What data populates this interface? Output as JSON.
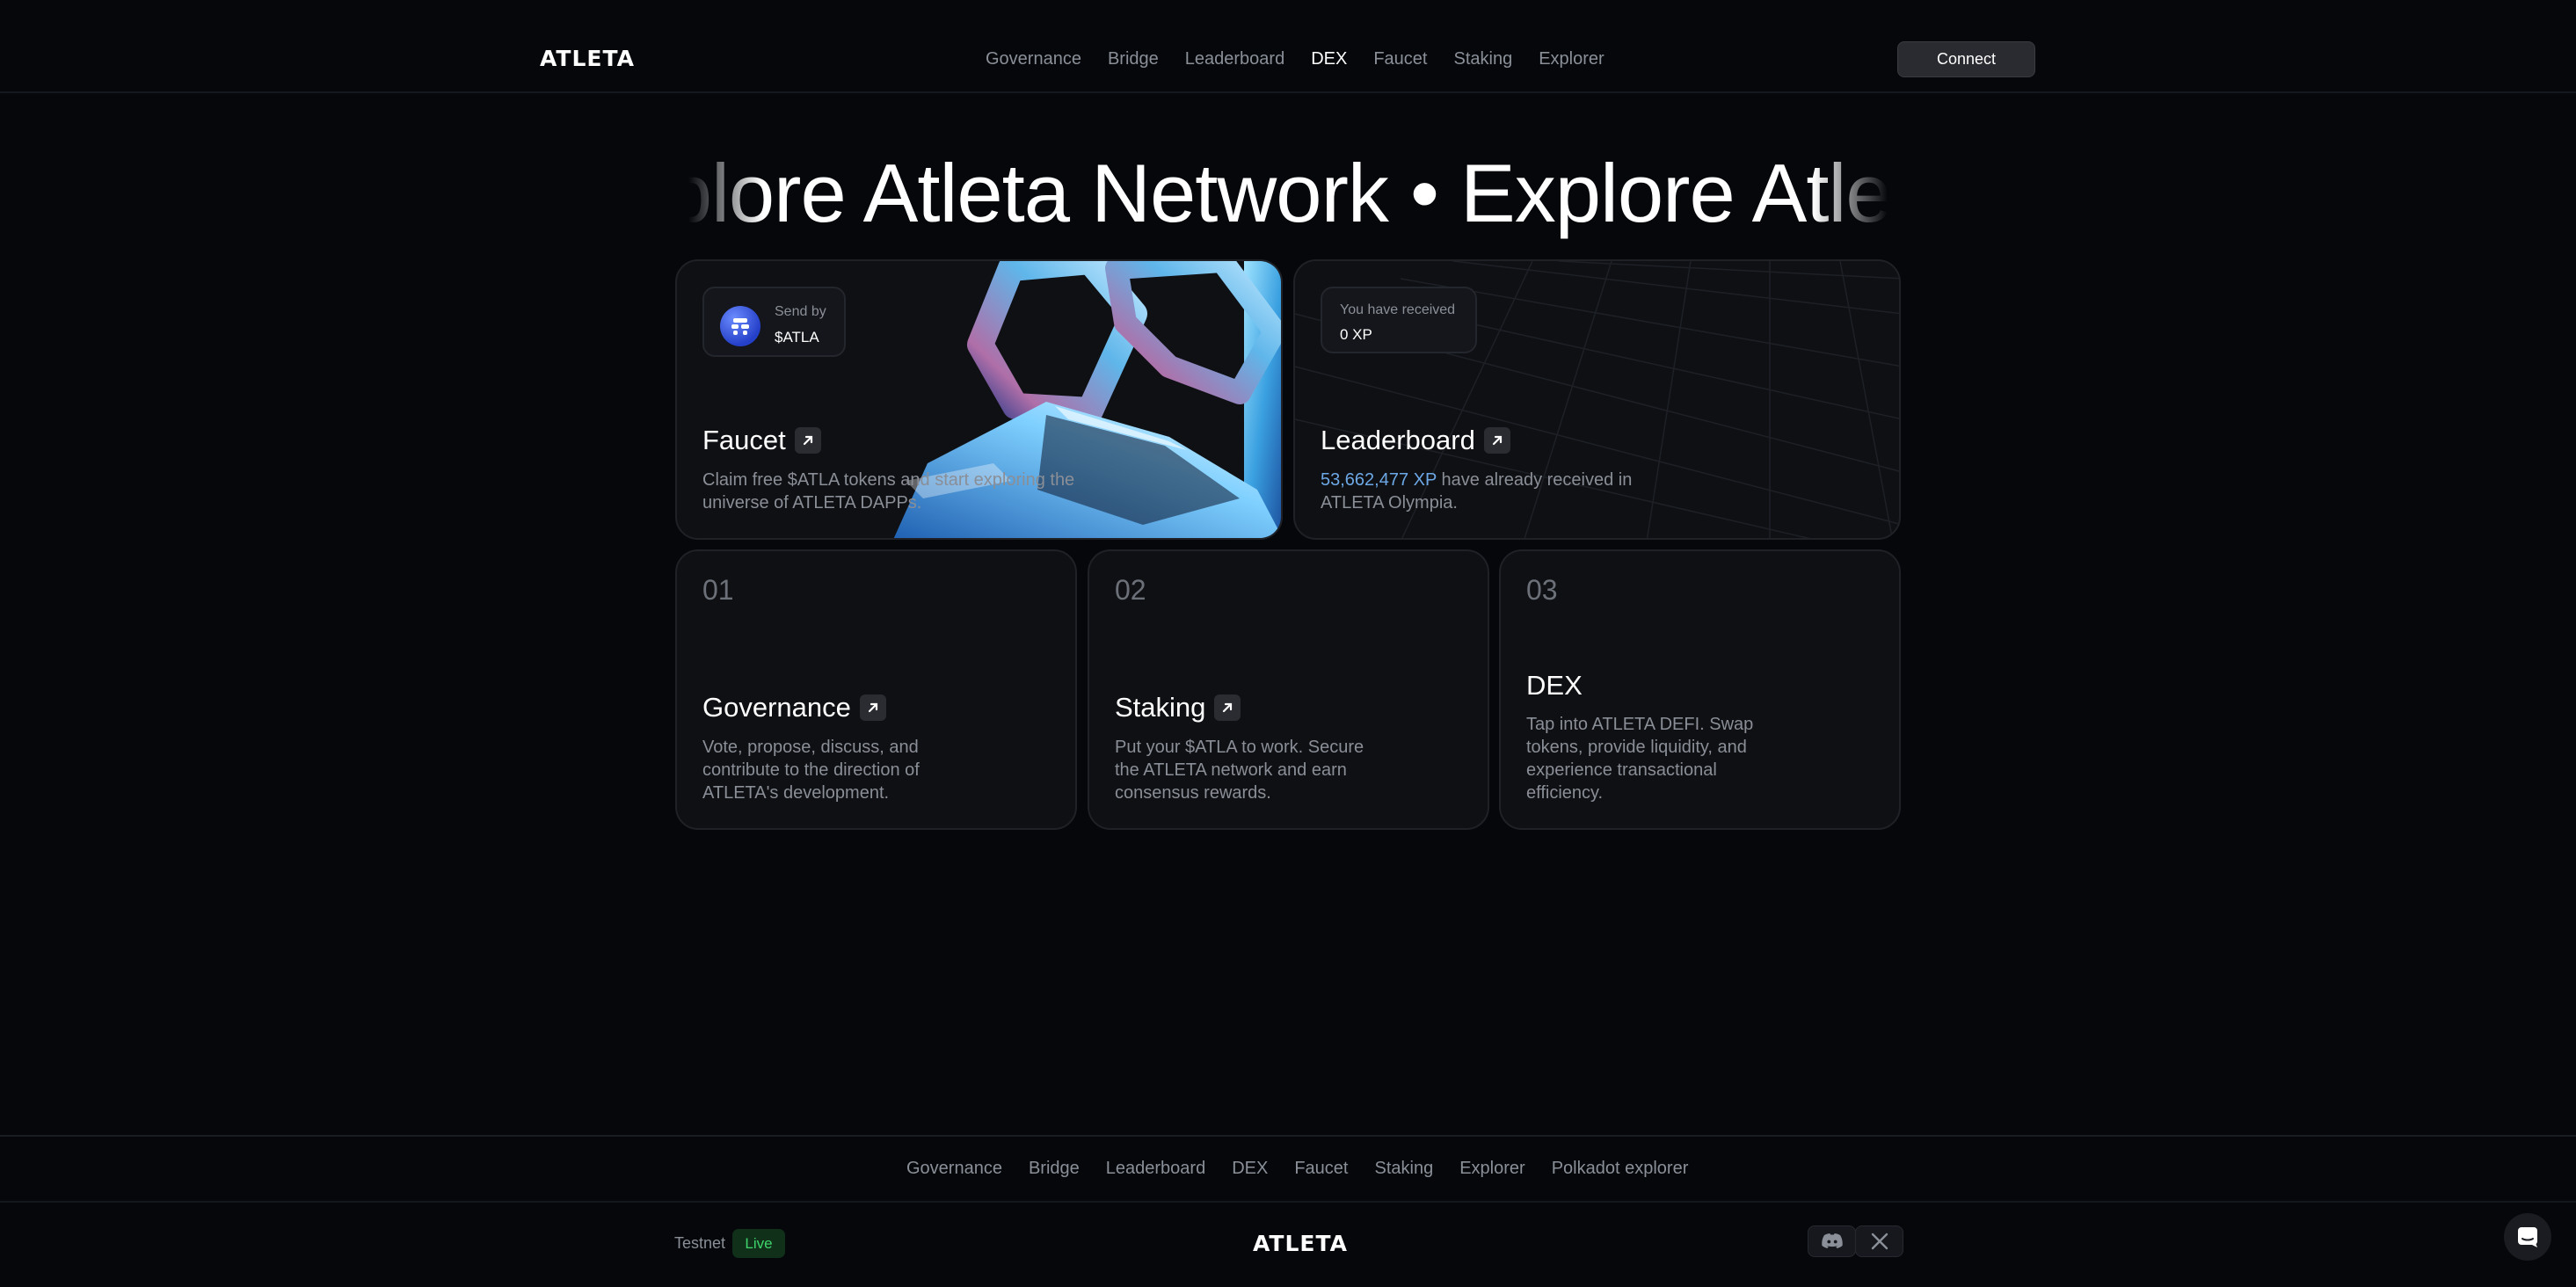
{
  "header": {
    "logo": "ATLETA",
    "nav": [
      {
        "label": "Governance",
        "active": false
      },
      {
        "label": "Bridge",
        "active": false
      },
      {
        "label": "Leaderboard",
        "active": false
      },
      {
        "label": "DEX",
        "active": true
      },
      {
        "label": "Faucet",
        "active": false
      },
      {
        "label": "Staking",
        "active": false
      },
      {
        "label": "Explorer",
        "active": false
      }
    ],
    "connect_label": "Connect"
  },
  "hero": {
    "marquee": "Explore Atleta Network • Explore Atleta Network"
  },
  "cards": {
    "faucet": {
      "chip_label": "Send by",
      "chip_value": "$ATLA",
      "title": "Faucet",
      "description": "Claim free $ATLA tokens and start exploring the universe of ATLETA DAPPs."
    },
    "leaderboard": {
      "chip_label": "You have received",
      "chip_value": "0 XP",
      "title": "Leaderboard",
      "xp_total": "53,662,477 XP",
      "description_rest": "have already received in ATLETA Olympia."
    },
    "governance": {
      "number": "01",
      "title": "Governance",
      "description": "Vote, propose, discuss, and contribute to the direction of ATLETA's development."
    },
    "staking": {
      "number": "02",
      "title": "Staking",
      "description": "Put your $ATLA to work. Secure the ATLETA network and earn consensus rewards."
    },
    "dex": {
      "number": "03",
      "title": "DEX",
      "description": "Tap into ATLETA DEFI. Swap tokens, provide liquidity, and experience transactional efficiency."
    }
  },
  "footer": {
    "links": [
      "Governance",
      "Bridge",
      "Leaderboard",
      "DEX",
      "Faucet",
      "Staking",
      "Explorer",
      "Polkadot explorer"
    ],
    "network_label": "Testnet",
    "status_badge": "Live",
    "logo": "ATLETA"
  },
  "icons": {
    "arrow": "arrow-up-right-icon",
    "discord": "discord-icon",
    "x": "x-icon",
    "chat": "chat-icon"
  },
  "colors": {
    "background": "#05070b",
    "card": "#0f1014",
    "accent_xp": "#6da8e6",
    "live_green": "#3fd46b"
  }
}
